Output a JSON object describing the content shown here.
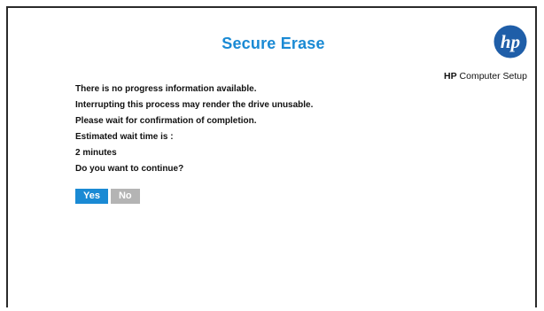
{
  "dialog": {
    "title": "Secure Erase",
    "logo_text": "hp",
    "app_brand": "HP",
    "app_name": "Computer Setup",
    "messages": [
      "There is no progress information available.",
      "Interrupting this process may render the drive unusable.",
      "Please wait for confirmation of completion.",
      "Estimated wait time is :",
      "2 minutes",
      "Do you want to continue?"
    ],
    "buttons": {
      "yes_label": "Yes",
      "no_label": "No"
    }
  },
  "colors": {
    "accent": "#1a8ad4",
    "disabled_button": "#b4b4b4",
    "frame": "#2a2a2a"
  },
  "icons": [
    "hp-logo-icon"
  ]
}
